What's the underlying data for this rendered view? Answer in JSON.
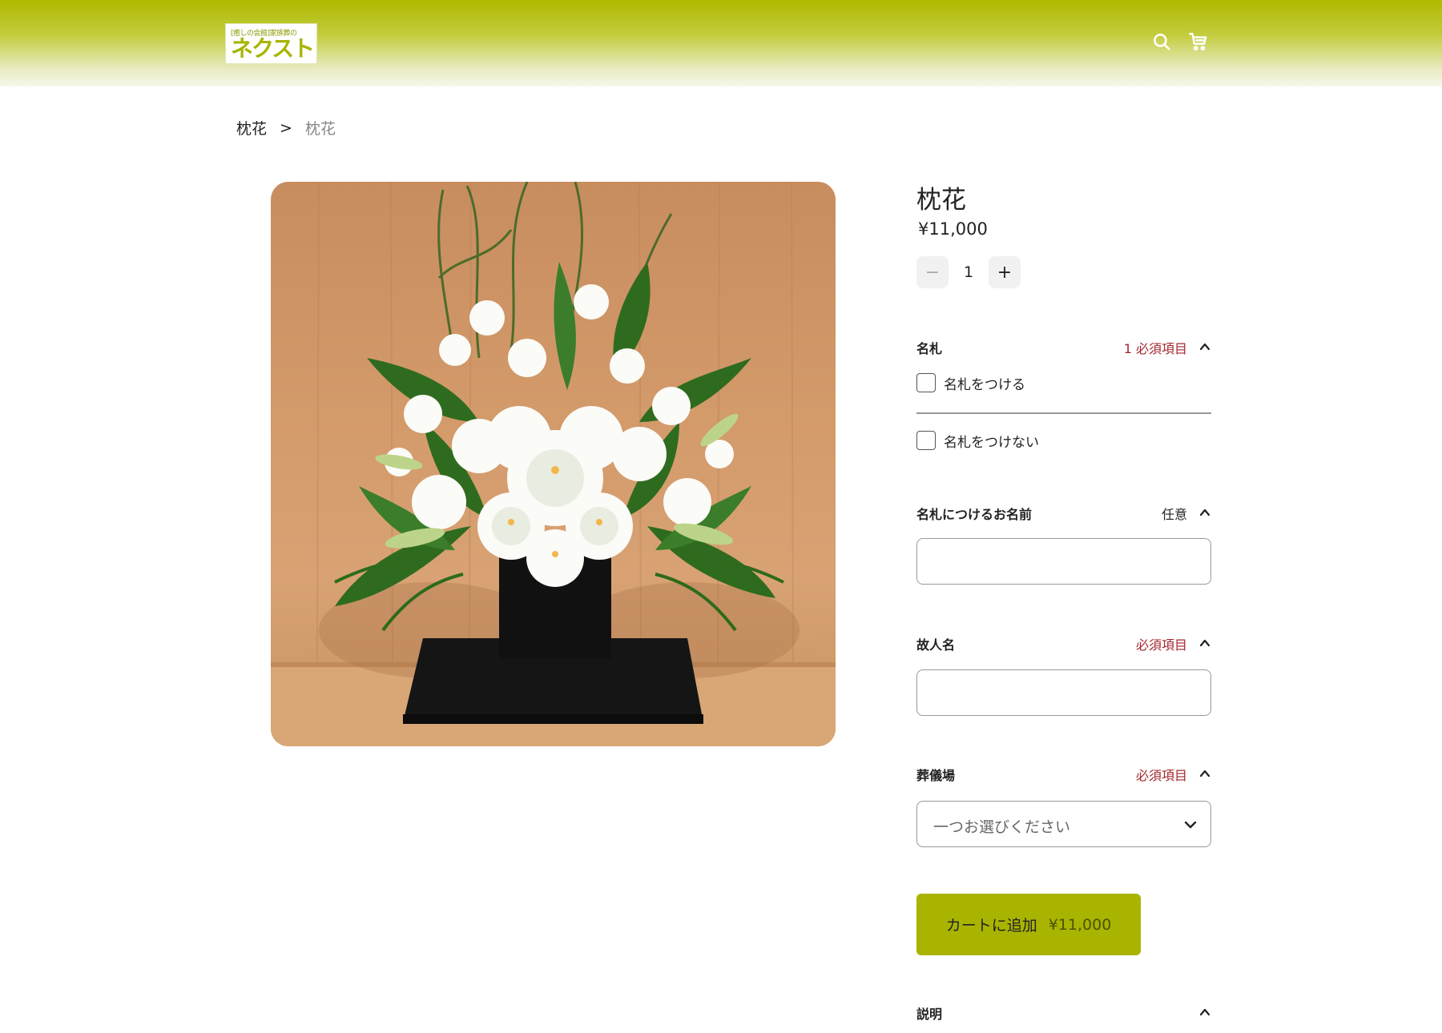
{
  "header": {
    "logo_small": "[癒しの会館]家族葬の",
    "logo_main": "ネクスト",
    "search_icon": "search-icon",
    "cart_icon": "cart-icon",
    "brand_color": "#afba00"
  },
  "breadcrumb": {
    "link": "枕花",
    "separator": ">",
    "current": "枕花"
  },
  "product": {
    "title": "枕花",
    "price": "¥11,000",
    "image_alt": "枕花"
  },
  "quantity": {
    "minus": "−",
    "value": "1",
    "plus": "+"
  },
  "options": {
    "nafuda": {
      "label": "名札",
      "status": "1 必須項目",
      "choices": [
        "名札をつける",
        "名札をつけない"
      ]
    },
    "nafuda_name": {
      "label": "名札につけるお名前",
      "status": "任意",
      "value": ""
    },
    "deceased_name": {
      "label": "故人名",
      "status": "必須項目",
      "value": ""
    },
    "venue": {
      "label": "葬儀場",
      "status": "必須項目",
      "selected": "一つお選びください"
    }
  },
  "add_to_cart": {
    "label": "カートに追加",
    "price": "¥11,000",
    "color": "#a9b400"
  },
  "description": {
    "label": "説明"
  },
  "colors": {
    "required": "#a3262d"
  }
}
